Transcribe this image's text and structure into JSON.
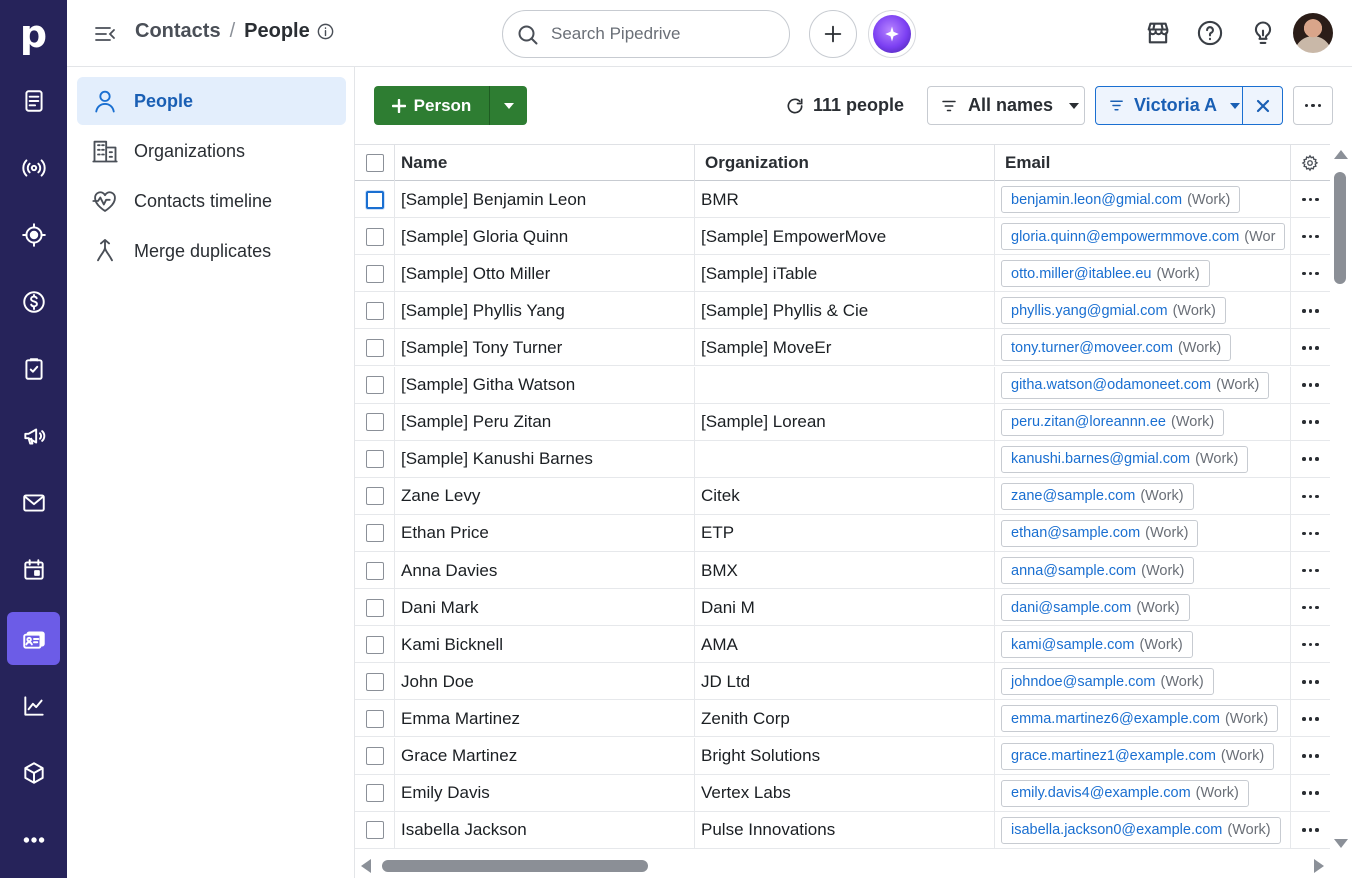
{
  "rail": {
    "logo": "p",
    "items": [
      {
        "icon": "leads-inbox-icon"
      },
      {
        "icon": "campaigns-broadcast-icon"
      },
      {
        "icon": "target-icon"
      },
      {
        "icon": "deals-dollar-icon"
      },
      {
        "icon": "activities-clipboard-icon"
      },
      {
        "icon": "megaphone-icon"
      },
      {
        "icon": "mail-icon"
      },
      {
        "icon": "calendar-icon"
      },
      {
        "icon": "contacts-card-icon",
        "active": true
      },
      {
        "icon": "insights-chart-icon"
      },
      {
        "icon": "products-box-icon"
      },
      {
        "icon": "more-dots-icon"
      }
    ]
  },
  "header": {
    "breadcrumb_parent": "Contacts",
    "breadcrumb_sep": "/",
    "breadcrumb_current": "People",
    "search_placeholder": "Search Pipedrive"
  },
  "subnav": [
    {
      "label": "People",
      "icon": "person-icon",
      "active": true
    },
    {
      "label": "Organizations",
      "icon": "building-icon"
    },
    {
      "label": "Contacts timeline",
      "icon": "heart-pulse-icon"
    },
    {
      "label": "Merge duplicates",
      "icon": "merge-icon"
    }
  ],
  "toolbar": {
    "add_label": "Person",
    "count_label": "111 people",
    "names_filter": "All names",
    "owner_filter": "Victoria A"
  },
  "table": {
    "columns": [
      "Name",
      "Organization",
      "Email"
    ],
    "rows": [
      {
        "name": "[Sample] Benjamin Leon",
        "org": "BMR",
        "email": "benjamin.leon@gmial.com",
        "label": "(Work)"
      },
      {
        "name": "[Sample] Gloria Quinn",
        "org": "[Sample] EmpowerMove",
        "email": "gloria.quinn@empowermmove.com",
        "label": "(Wor"
      },
      {
        "name": "[Sample] Otto Miller",
        "org": "[Sample] iTable",
        "email": "otto.miller@itablee.eu",
        "label": "(Work)"
      },
      {
        "name": "[Sample] Phyllis Yang",
        "org": "[Sample] Phyllis & Cie",
        "email": "phyllis.yang@gmial.com",
        "label": "(Work)"
      },
      {
        "name": "[Sample] Tony Turner",
        "org": "[Sample] MoveEr",
        "email": "tony.turner@moveer.com",
        "label": "(Work)"
      },
      {
        "name": "[Sample] Githa Watson",
        "org": "",
        "email": "githa.watson@odamoneet.com",
        "label": "(Work)"
      },
      {
        "name": "[Sample] Peru Zitan",
        "org": "[Sample] Lorean",
        "email": "peru.zitan@loreannn.ee",
        "label": "(Work)"
      },
      {
        "name": "[Sample] Kanushi Barnes",
        "org": "",
        "email": "kanushi.barnes@gmial.com",
        "label": "(Work)"
      },
      {
        "name": "Zane Levy",
        "org": "Citek",
        "email": "zane@sample.com",
        "label": "(Work)"
      },
      {
        "name": "Ethan Price",
        "org": "ETP",
        "email": "ethan@sample.com",
        "label": "(Work)"
      },
      {
        "name": "Anna Davies",
        "org": "BMX",
        "email": "anna@sample.com",
        "label": "(Work)"
      },
      {
        "name": "Dani Mark",
        "org": "Dani M",
        "email": "dani@sample.com",
        "label": "(Work)"
      },
      {
        "name": "Kami Bicknell",
        "org": "AMA",
        "email": "kami@sample.com",
        "label": "(Work)"
      },
      {
        "name": "John Doe",
        "org": "JD Ltd",
        "email": "johndoe@sample.com",
        "label": "(Work)"
      },
      {
        "name": "Emma Martinez",
        "org": "Zenith Corp",
        "email": "emma.martinez6@example.com",
        "label": "(Work)"
      },
      {
        "name": "Grace Martinez",
        "org": "Bright Solutions",
        "email": "grace.martinez1@example.com",
        "label": "(Work)"
      },
      {
        "name": "Emily Davis",
        "org": "Vertex Labs",
        "email": "emily.davis4@example.com",
        "label": "(Work)"
      },
      {
        "name": "Isabella Jackson",
        "org": "Pulse Innovations",
        "email": "isabella.jackson0@example.com",
        "label": "(Work)"
      }
    ]
  },
  "colors": {
    "rail_bg": "#26235a",
    "rail_active": "#6c5ce7",
    "primary_green": "#2e7d32",
    "link_blue": "#1a6fd1",
    "active_nav_bg": "#e3eefc"
  }
}
